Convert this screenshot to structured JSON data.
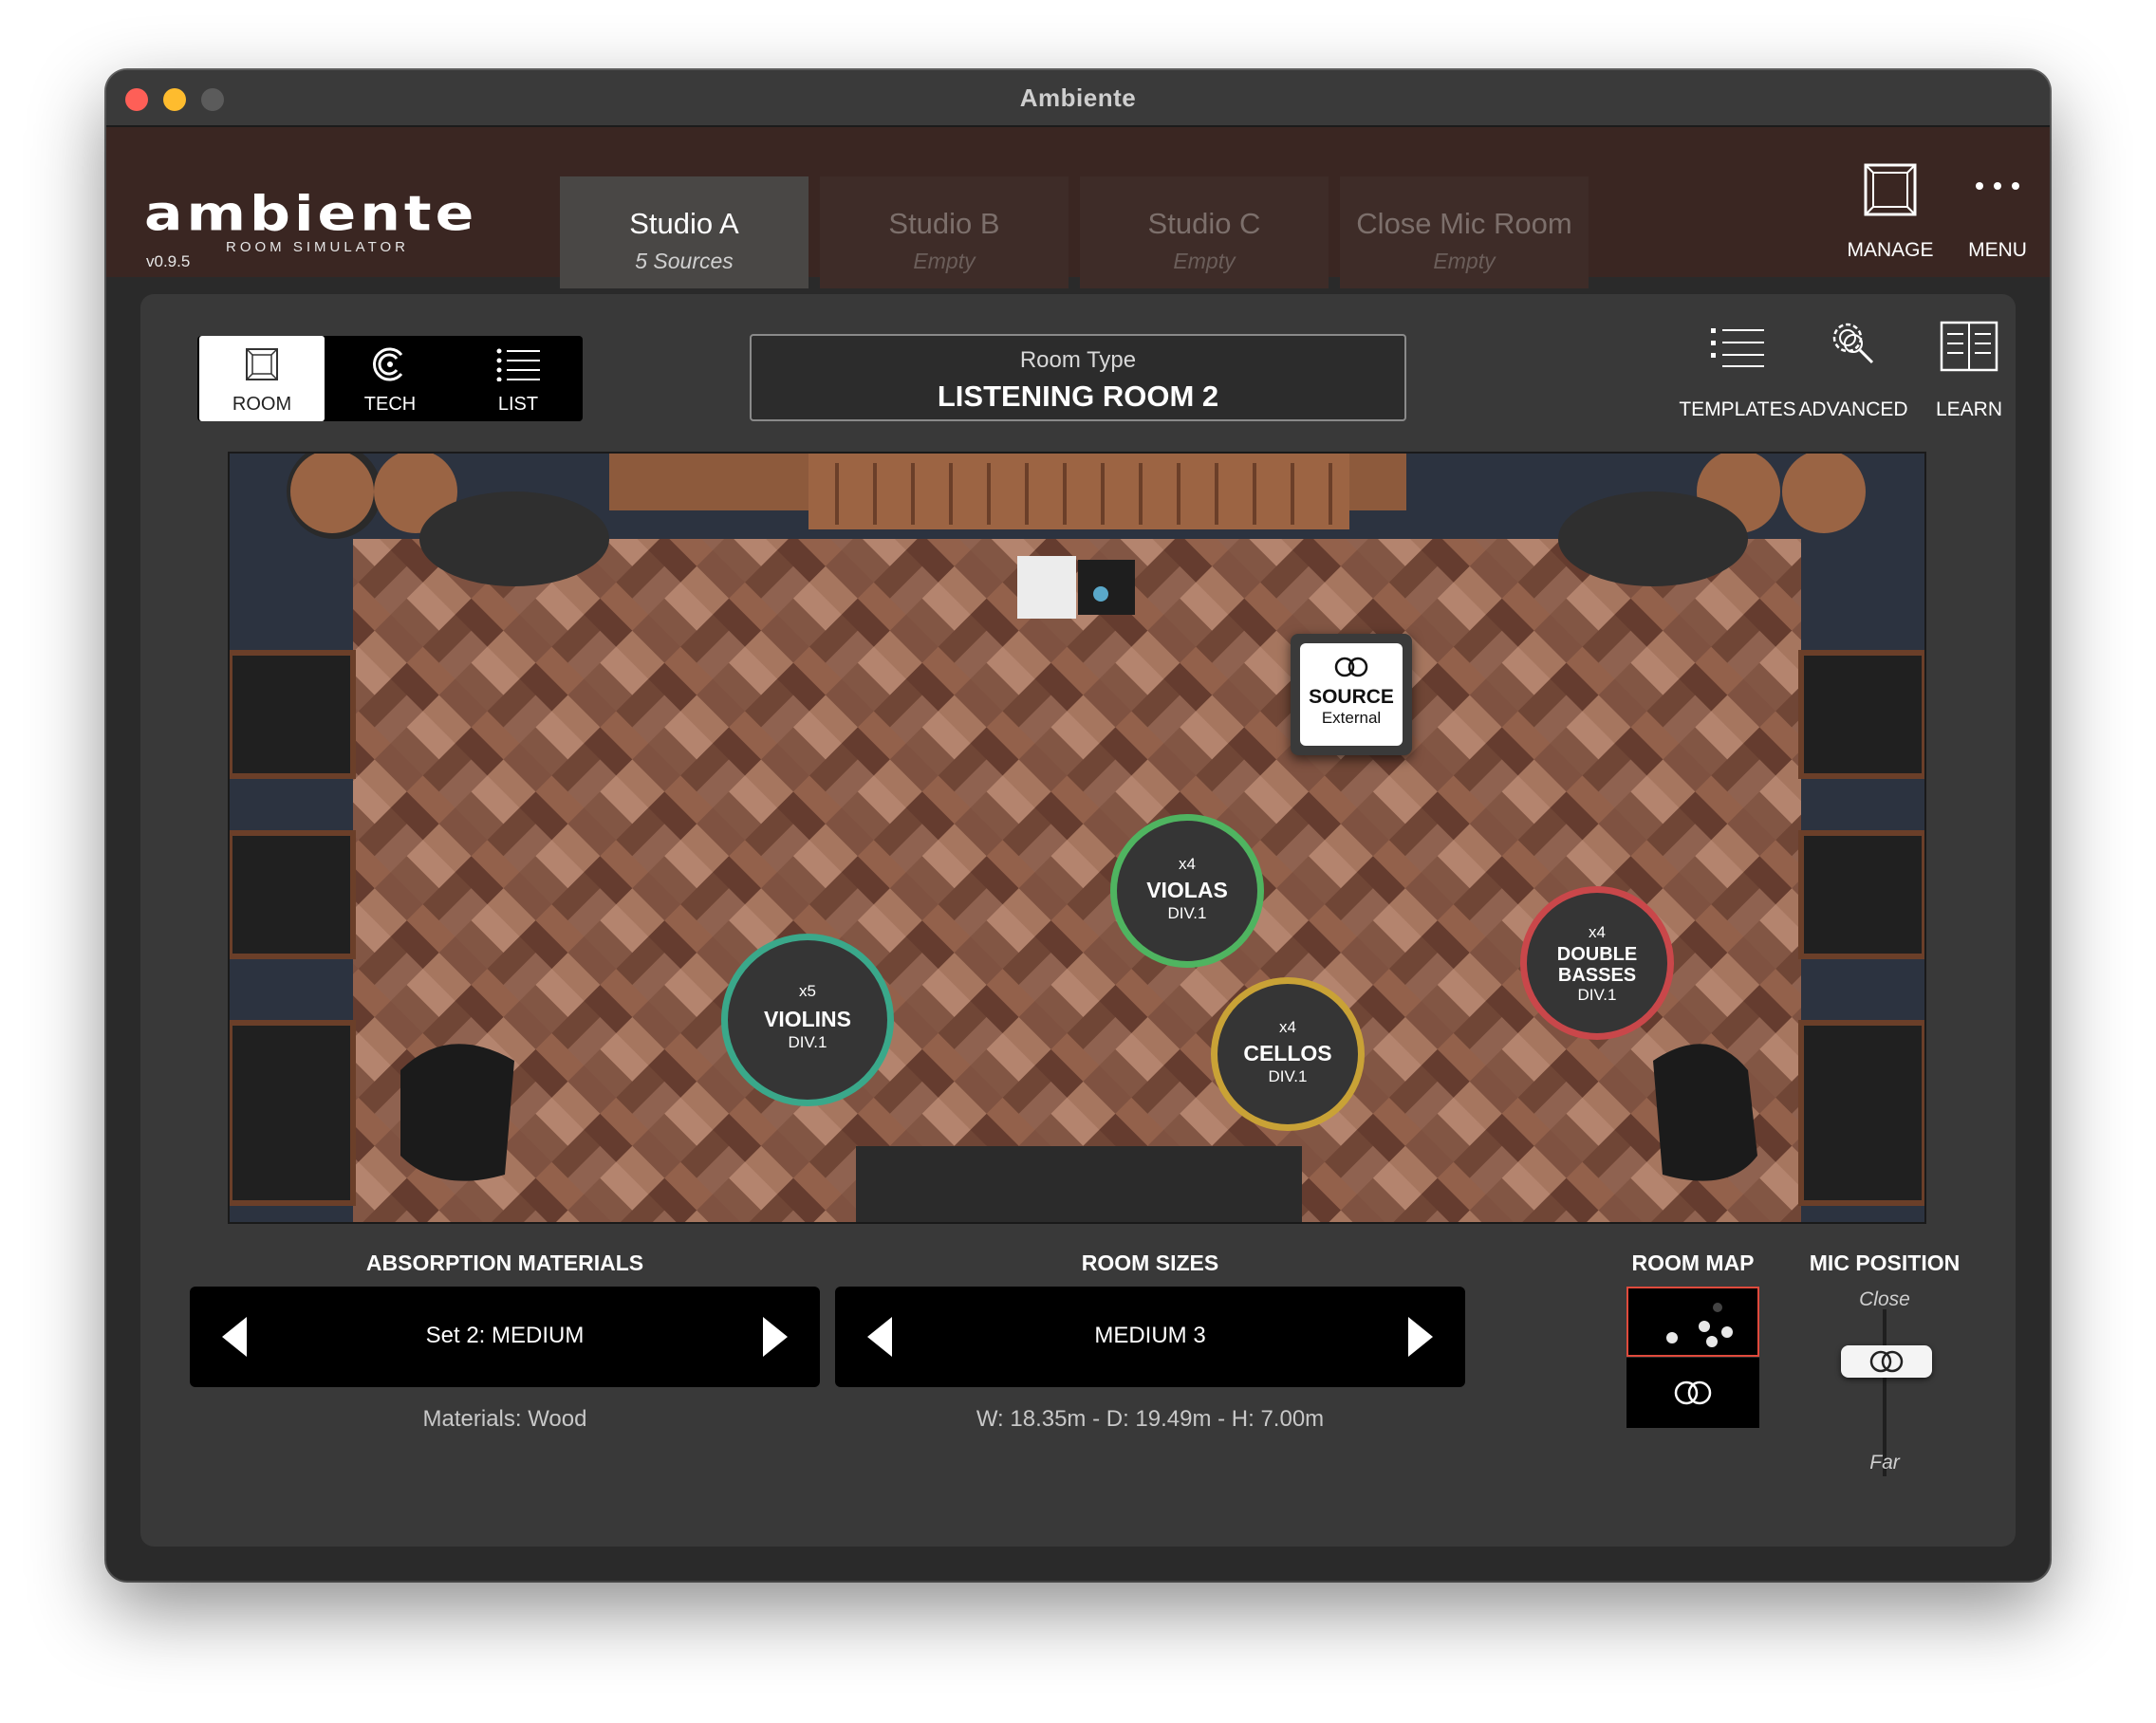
{
  "window": {
    "title": "Ambiente"
  },
  "header": {
    "logo_text": "ambiente",
    "logo_subtitle": "ROOM SIMULATOR",
    "version": "v0.9.5",
    "tabs": [
      {
        "label": "Studio A",
        "sub": "5 Sources",
        "active": true
      },
      {
        "label": "Studio B",
        "sub": "Empty",
        "active": false
      },
      {
        "label": "Studio C",
        "sub": "Empty",
        "active": false
      },
      {
        "label": "Close Mic Room",
        "sub": "Empty",
        "active": false
      }
    ],
    "manage_label": "MANAGE",
    "menu_label": "MENU"
  },
  "view_modes": {
    "room": "ROOM",
    "tech": "TECH",
    "list": "LIST",
    "selected": "ROOM"
  },
  "room_type": {
    "title": "Room Type",
    "value": "LISTENING ROOM 2"
  },
  "tools": {
    "templates": "TEMPLATES",
    "advanced": "ADVANCED",
    "learn": "LEARN"
  },
  "sources": [
    {
      "count": "x5",
      "name": "VIOLINS",
      "div": "DIV.1",
      "color": "#3aa88a"
    },
    {
      "count": "x4",
      "name": "VIOLAS",
      "div": "DIV.1",
      "color": "#4fb460"
    },
    {
      "count": "x4",
      "name": "CELLOS",
      "div": "DIV.1",
      "color": "#c9a236"
    },
    {
      "count": "x4",
      "name": "DOUBLE BASSES",
      "name_line1": "DOUBLE",
      "name_line2": "BASSES",
      "div": "DIV.1",
      "color": "#c9474a"
    }
  ],
  "external_source": {
    "name": "SOURCE",
    "sub": "External"
  },
  "absorption": {
    "title": "ABSORPTION MATERIALS",
    "value": "Set 2: MEDIUM",
    "caption": "Materials: Wood"
  },
  "room_sizes": {
    "title": "ROOM SIZES",
    "value": "MEDIUM 3",
    "caption": "W: 18.35m - D: 19.49m - H: 7.00m"
  },
  "room_map": {
    "title": "ROOM MAP"
  },
  "mic_position": {
    "title": "MIC POSITION",
    "top_label": "Close",
    "bottom_label": "Far"
  },
  "colors": {
    "accent_red": "#e04a3c",
    "header_bg": "#3a2622",
    "panel_bg": "#393939"
  }
}
